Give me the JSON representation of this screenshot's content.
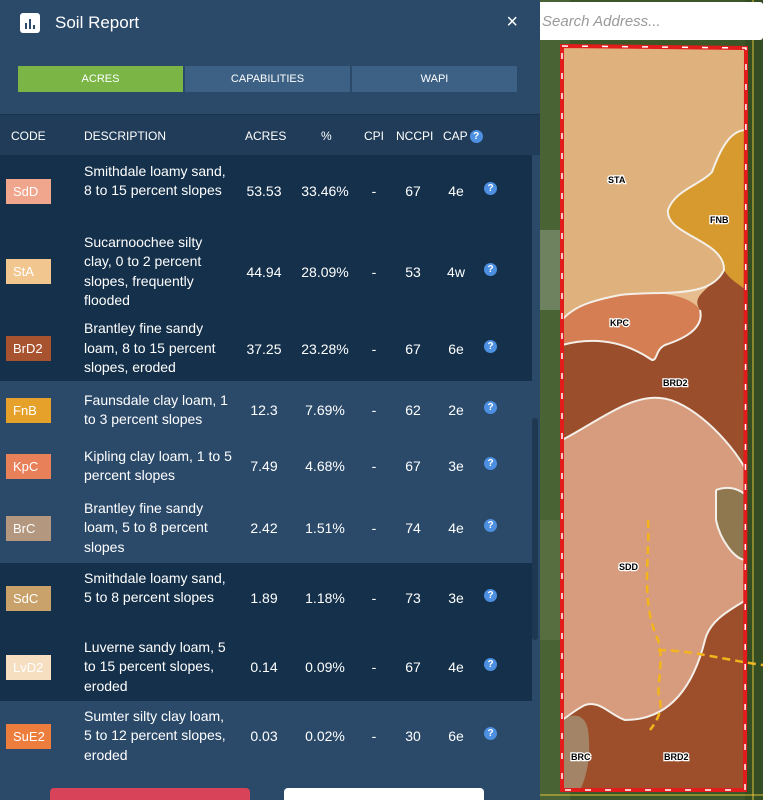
{
  "panel": {
    "title": "Soil Report",
    "close_icon": "×"
  },
  "search": {
    "placeholder": "Search Address..."
  },
  "tabs": [
    {
      "label": "ACRES",
      "active": true
    },
    {
      "label": "CAPABILITIES",
      "active": false
    },
    {
      "label": "WAPI",
      "active": false
    }
  ],
  "headers": {
    "code": "CODE",
    "description": "DESCRIPTION",
    "acres": "ACRES",
    "pct": "%",
    "cpi": "CPI",
    "nccpi": "NCCPI",
    "cap": "CAP"
  },
  "rows": [
    {
      "code": "SdD",
      "color": "#f0a58d",
      "description": "Smithdale loamy sand, 8 to 15 percent slopes",
      "acres": "53.53",
      "pct": "33.46%",
      "cpi": "-",
      "nccpi": "67",
      "cap": "4e"
    },
    {
      "code": "StA",
      "color": "#f1c68f",
      "description": "Sucarnoochee silty clay, 0 to 2 percent slopes, frequently flooded",
      "acres": "44.94",
      "pct": "28.09%",
      "cpi": "-",
      "nccpi": "53",
      "cap": "4w"
    },
    {
      "code": "BrD2",
      "color": "#a8532f",
      "description": "Brantley fine sandy loam, 8 to 15 percent slopes, eroded",
      "acres": "37.25",
      "pct": "23.28%",
      "cpi": "-",
      "nccpi": "67",
      "cap": "6e"
    },
    {
      "code": "FnB",
      "color": "#e5a129",
      "description": "Faunsdale clay loam, 1 to 3 percent slopes",
      "acres": "12.3",
      "pct": "7.69%",
      "cpi": "-",
      "nccpi": "62",
      "cap": "2e"
    },
    {
      "code": "KpC",
      "color": "#e8815a",
      "description": "Kipling clay loam, 1 to 5 percent slopes",
      "acres": "7.49",
      "pct": "4.68%",
      "cpi": "-",
      "nccpi": "67",
      "cap": "3e"
    },
    {
      "code": "BrC",
      "color": "#b3977f",
      "description": "Brantley fine sandy loam, 5 to 8 percent slopes",
      "acres": "2.42",
      "pct": "1.51%",
      "cpi": "-",
      "nccpi": "74",
      "cap": "4e"
    },
    {
      "code": "SdC",
      "color": "#c8a26a",
      "description": "Smithdale loamy sand, 5 to 8 percent slopes",
      "acres": "1.89",
      "pct": "1.18%",
      "cpi": "-",
      "nccpi": "73",
      "cap": "3e"
    },
    {
      "code": "LvD2",
      "color": "#f6dfc1",
      "description": "Luverne sandy loam, 5 to 15 percent slopes, eroded",
      "acres": "0.14",
      "pct": "0.09%",
      "cpi": "-",
      "nccpi": "67",
      "cap": "4e"
    },
    {
      "code": "SuE2",
      "color": "#ed7d3c",
      "description": "Sumter silty clay loam, 5 to 12 percent slopes, eroded",
      "acres": "0.03",
      "pct": "0.02%",
      "cpi": "-",
      "nccpi": "30",
      "cap": "6e"
    }
  ],
  "map_labels": [
    "STA",
    "FNB",
    "KPC",
    "BRD2",
    "SDD",
    "BRC",
    "BRD2"
  ],
  "icons": {
    "report": "bar-chart-icon",
    "help": "question-circle-icon",
    "close": "close-icon"
  },
  "colors": {
    "accent_tab": "#7ab546",
    "field_boundary": "#e21b1b",
    "help": "#4d8fe0"
  }
}
